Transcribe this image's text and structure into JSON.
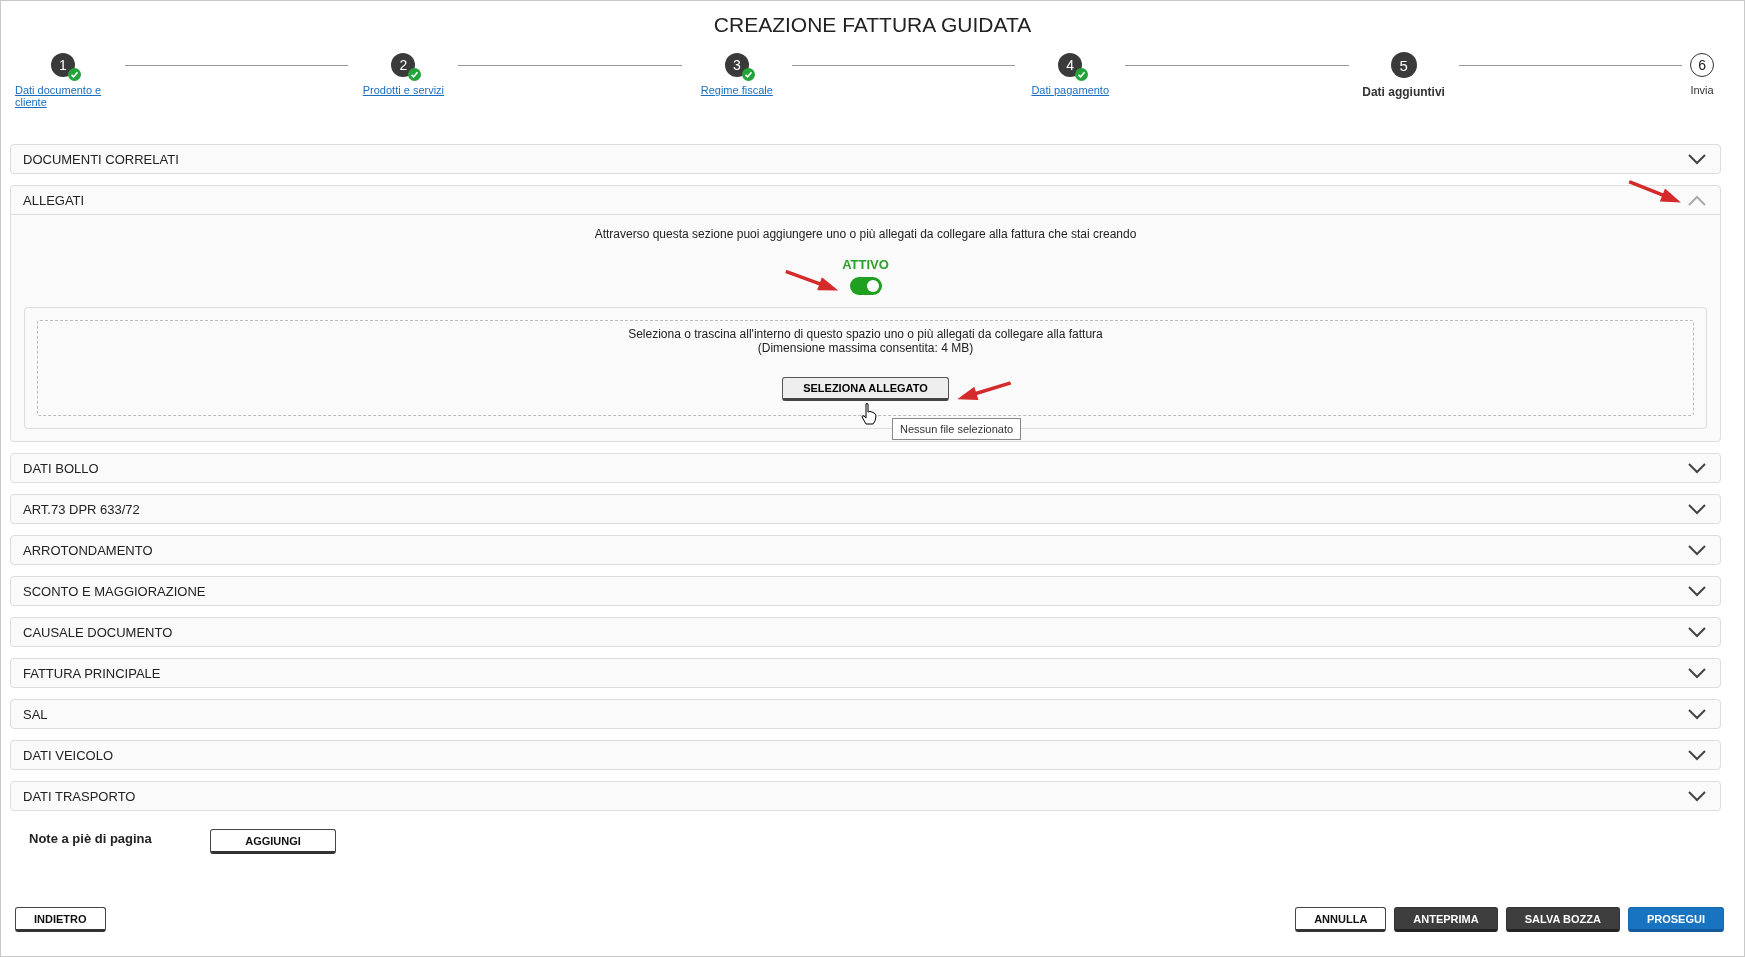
{
  "title": "CREAZIONE FATTURA GUIDATA",
  "steps": [
    {
      "number": "1",
      "label": "Dati documento e cliente",
      "completed": true,
      "selected": false
    },
    {
      "number": "2",
      "label": "Prodotti e servizi",
      "completed": true,
      "selected": false
    },
    {
      "number": "3",
      "label": "Regime fiscale",
      "completed": true,
      "selected": false
    },
    {
      "number": "4",
      "label": "Dati pagamento",
      "completed": true,
      "selected": false
    },
    {
      "number": "5",
      "label": "Dati aggiuntivi",
      "completed": false,
      "selected": true
    },
    {
      "number": "6",
      "label": "Invia",
      "completed": false,
      "selected": false
    }
  ],
  "sections": [
    {
      "title": "DOCUMENTI CORRELATI",
      "expanded": false
    },
    {
      "title": "ALLEGATI",
      "expanded": true,
      "content": {
        "intro": "Attraverso questa sezione puoi aggiungere uno o più allegati da collegare alla fattura che stai creando",
        "toggle": {
          "label": "ATTIVO",
          "on": true
        },
        "dropzone": {
          "text": "Seleziona o trascina all'interno di questo spazio uno o più allegati da collegare alla fattura",
          "limit": "(Dimensione massima consentita: 4 MB)",
          "button": "SELEZIONA ALLEGATO",
          "tooltip": "Nessun file selezionato"
        }
      }
    },
    {
      "title": "DATI BOLLO",
      "expanded": false
    },
    {
      "title": "ART.73 DPR 633/72",
      "expanded": false
    },
    {
      "title": "ARROTONDAMENTO",
      "expanded": false
    },
    {
      "title": "SCONTO E MAGGIORAZIONE",
      "expanded": false
    },
    {
      "title": "CAUSALE DOCUMENTO",
      "expanded": false
    },
    {
      "title": "FATTURA PRINCIPALE",
      "expanded": false
    },
    {
      "title": "SAL",
      "expanded": false
    },
    {
      "title": "DATI VEICOLO",
      "expanded": false
    },
    {
      "title": "DATI TRASPORTO",
      "expanded": false
    }
  ],
  "footnotes": {
    "label": "Note a piè di pagina",
    "button": "AGGIUNGI"
  },
  "actions": {
    "left": [
      {
        "label": "INDIETRO",
        "kind": "outline"
      }
    ],
    "right": [
      {
        "label": "ANNULLA",
        "kind": "outline"
      },
      {
        "label": "ANTEPRIMA",
        "kind": "dark"
      },
      {
        "label": "SALVA BOZZA",
        "kind": "dark"
      },
      {
        "label": "PROSEGUI",
        "kind": "primary"
      }
    ]
  }
}
